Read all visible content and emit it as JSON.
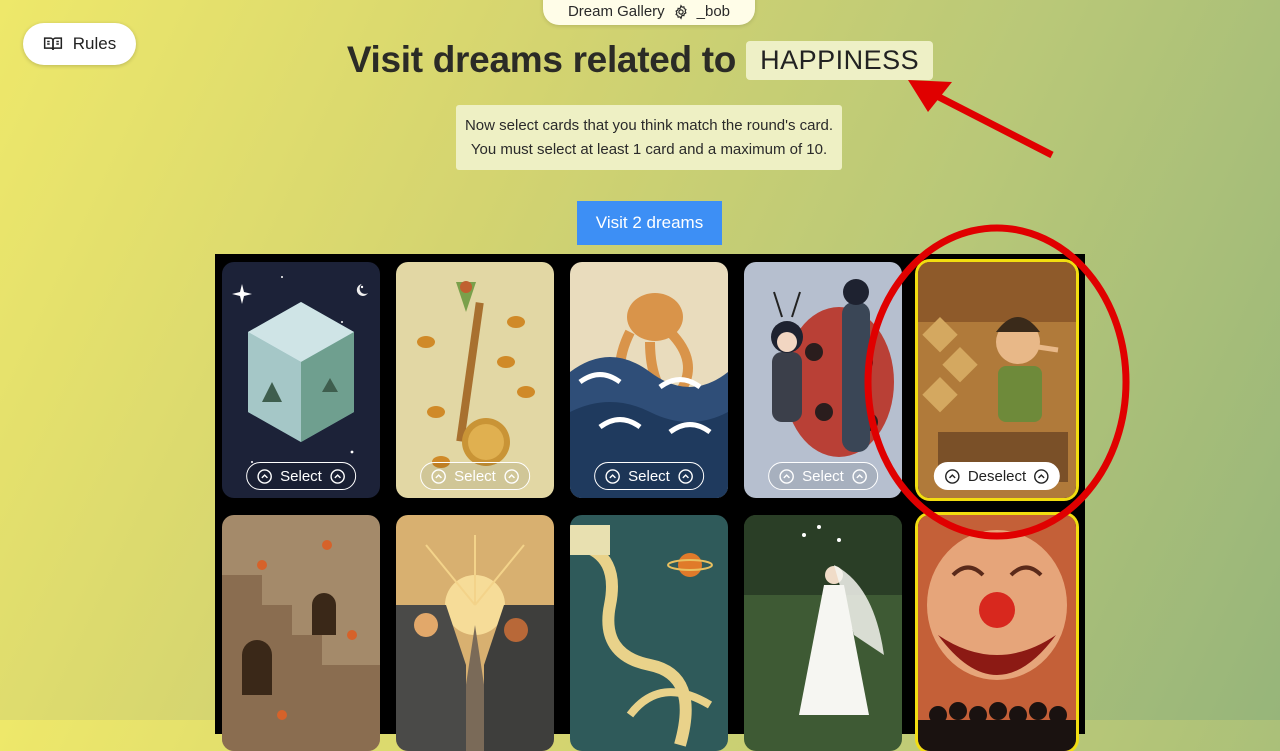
{
  "header": {
    "game_name": "Dream Gallery",
    "settings_icon": "gear-icon",
    "user": "_bob"
  },
  "rules_button": {
    "label": "Rules",
    "icon": "book-icon"
  },
  "title": {
    "prefix": "Visit dreams related to",
    "keyword": "HAPPINESS"
  },
  "instructions": {
    "line1": "Now select cards that you think match the round's card.",
    "line2": "You must select at least 1 card and a maximum of 10."
  },
  "visit_button": {
    "label": "Visit 2 dreams"
  },
  "colors": {
    "accent_blue": "#3d8ff5",
    "selected_border": "#f2dd10",
    "annotation_red": "#e00000",
    "board": "#000000"
  },
  "cards": [
    {
      "scene": "crystal-cube-in-space",
      "button": "Select",
      "selected": false
    },
    {
      "scene": "girl-on-spoon-with-bees",
      "button": "Select",
      "selected": false
    },
    {
      "scene": "octopus-in-waves",
      "button": "Select",
      "selected": false
    },
    {
      "scene": "boy-and-woman-with-ladybug",
      "button": "Select",
      "selected": false
    },
    {
      "scene": "pinocchio-workshop",
      "button": "Deselect",
      "selected": true
    },
    {
      "scene": "impossible-stairs-with-foxes",
      "button": "",
      "selected": false
    },
    {
      "scene": "cars-at-sunset",
      "button": "",
      "selected": false
    },
    {
      "scene": "measuring-tape-and-planet",
      "button": "",
      "selected": false
    },
    {
      "scene": "bride-in-garden",
      "button": "",
      "selected": false
    },
    {
      "scene": "clown-face-with-crowd",
      "button": "",
      "selected": true
    }
  ]
}
